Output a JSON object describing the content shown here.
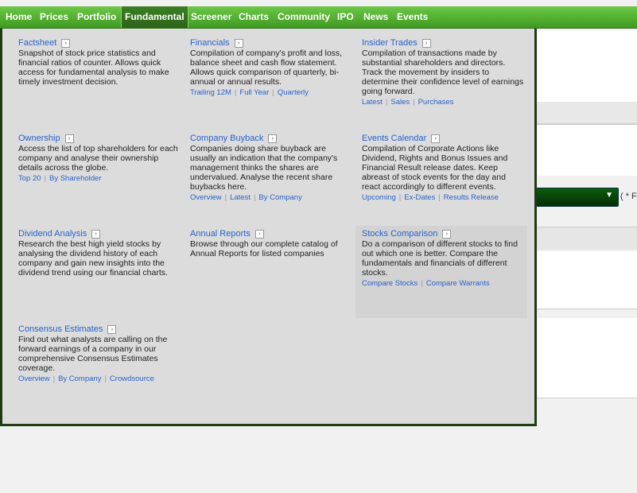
{
  "nav": [
    "Home",
    "Prices",
    "Portfolio",
    "Fundamental",
    "Screener",
    "Charts",
    "Community",
    "IPO",
    "News",
    "Events"
  ],
  "active_nav": "Fundamental",
  "background": {
    "note": "( * F"
  },
  "cards": [
    {
      "title": "Factsheet",
      "desc": "Snapshot of stock price statistics and financial ratios of counter. Allows quick access for fundamental analysis to make timely investment decision.",
      "links": []
    },
    {
      "title": "Financials",
      "desc": "Compilation of company's profit and loss, balance sheet and cash flow statement. Allows quick comparison of quarterly, bi-annual or annual results.",
      "links": [
        "Trailing 12M",
        "Full Year",
        "Quarterly"
      ]
    },
    {
      "title": "Insider Trades",
      "desc": "Compilation of transactions made by substantial shareholders and directors. Track the movement by insiders to determine their confidence level of earnings going forward.",
      "links": [
        "Latest",
        "Sales",
        "Purchases"
      ]
    },
    {
      "title": "Ownership",
      "desc": "Access the list of top shareholders for each company and analyse their ownership details across the globe.",
      "links": [
        "Top 20",
        "By Shareholder"
      ]
    },
    {
      "title": "Company Buyback",
      "desc": "Companies doing share buyback are usually an indication that the company's management thinks the shares are undervalued. Analyse the recent share buybacks here.",
      "links": [
        "Overview",
        "Latest",
        "By Company"
      ]
    },
    {
      "title": "Events Calendar",
      "desc": "Compilation of Corporate Actions like Dividend, Rights and Bonus Issues and Financial Result release dates. Keep abreast of stock events for the day and react accordingly to different events.",
      "links": [
        "Upcoming",
        "Ex-Dates",
        "Results Release"
      ]
    },
    {
      "title": "Dividend Analysis",
      "desc": "Research the best high yield stocks by analysing the dividend history of each company and gain new insights into the dividend trend using our financial charts.",
      "links": []
    },
    {
      "title": "Annual Reports",
      "desc": "Browse through our complete catalog of Annual Reports for listed companies",
      "links": []
    },
    {
      "title": "Stocks Comparison",
      "desc": "Do a comparison of different stocks to find out which one is better. Compare the fundamentals and financials of different stocks.",
      "links": [
        "Compare Stocks",
        "Compare Warrants"
      ]
    },
    {
      "title": "Consensus Estimates",
      "desc": "Find out what analysts are calling on the forward earnings of a company in our comprehensive Consensus Estimates coverage.",
      "links": [
        "Overview",
        "By Company",
        "Crowdsource"
      ]
    }
  ]
}
